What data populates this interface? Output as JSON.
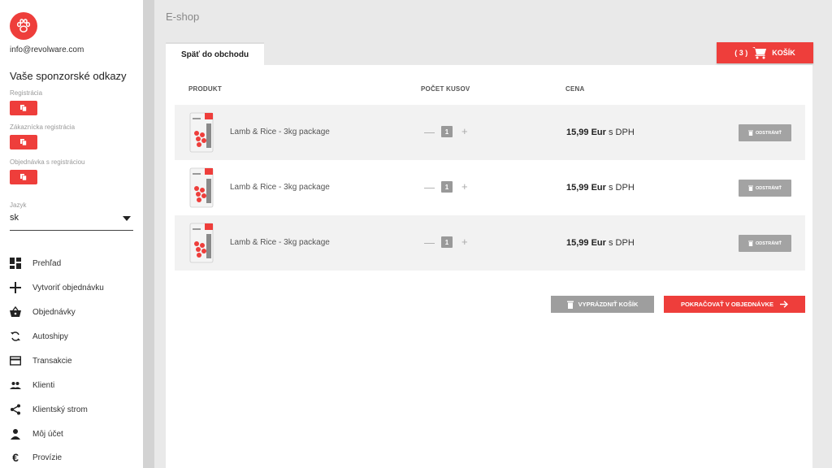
{
  "sidebar": {
    "email": "info@revolware.com",
    "sponsor_title": "Vaše sponzorské odkazy",
    "referral_links": [
      {
        "label": "Registrácia"
      },
      {
        "label": "Zákaznícka registrácia"
      },
      {
        "label": "Objednávka s registráciou"
      }
    ],
    "language": {
      "label": "Jazyk",
      "value": "sk"
    },
    "nav": [
      {
        "label": "Prehľad",
        "icon": "dashboard-icon"
      },
      {
        "label": "Vytvoriť objednávku",
        "icon": "plus-icon"
      },
      {
        "label": "Objednávky",
        "icon": "basket-icon"
      },
      {
        "label": "Autoshipy",
        "icon": "sync-icon"
      },
      {
        "label": "Transakcie",
        "icon": "credit-card-icon"
      },
      {
        "label": "Klienti",
        "icon": "people-icon"
      },
      {
        "label": "Klientský strom",
        "icon": "share-icon"
      },
      {
        "label": "Môj účet",
        "icon": "person-icon"
      },
      {
        "label": "Provízie",
        "icon": "euro-icon"
      }
    ]
  },
  "header": {
    "title": "E-shop"
  },
  "tab": {
    "label": "Späť do obchodu"
  },
  "cart_button": {
    "count": "( 3 )",
    "label": "KOŠÍK"
  },
  "table": {
    "headers": {
      "product": "PRODUKT",
      "qty": "POČET KUSOV",
      "price": "CENA"
    },
    "rows": [
      {
        "name": "Lamb & Rice - 3kg package",
        "qty": "1",
        "price": "15,99 Eur",
        "price_suffix": " s DPH",
        "remove": "ODSTRÁNIŤ"
      },
      {
        "name": "Lamb & Rice - 3kg package",
        "qty": "1",
        "price": "15,99 Eur",
        "price_suffix": " s DPH",
        "remove": "ODSTRÁNIŤ"
      },
      {
        "name": "Lamb & Rice - 3kg package",
        "qty": "1",
        "price": "15,99 Eur",
        "price_suffix": " s DPH",
        "remove": "ODSTRÁNIŤ"
      }
    ]
  },
  "actions": {
    "empty_cart": "VYPRÁZDNIŤ KOŠÍK",
    "continue": "POKRAČOVAŤ V OBJEDNÁVKE"
  },
  "colors": {
    "accent": "#ee3e3b",
    "grey_button": "#a3a3a3"
  }
}
